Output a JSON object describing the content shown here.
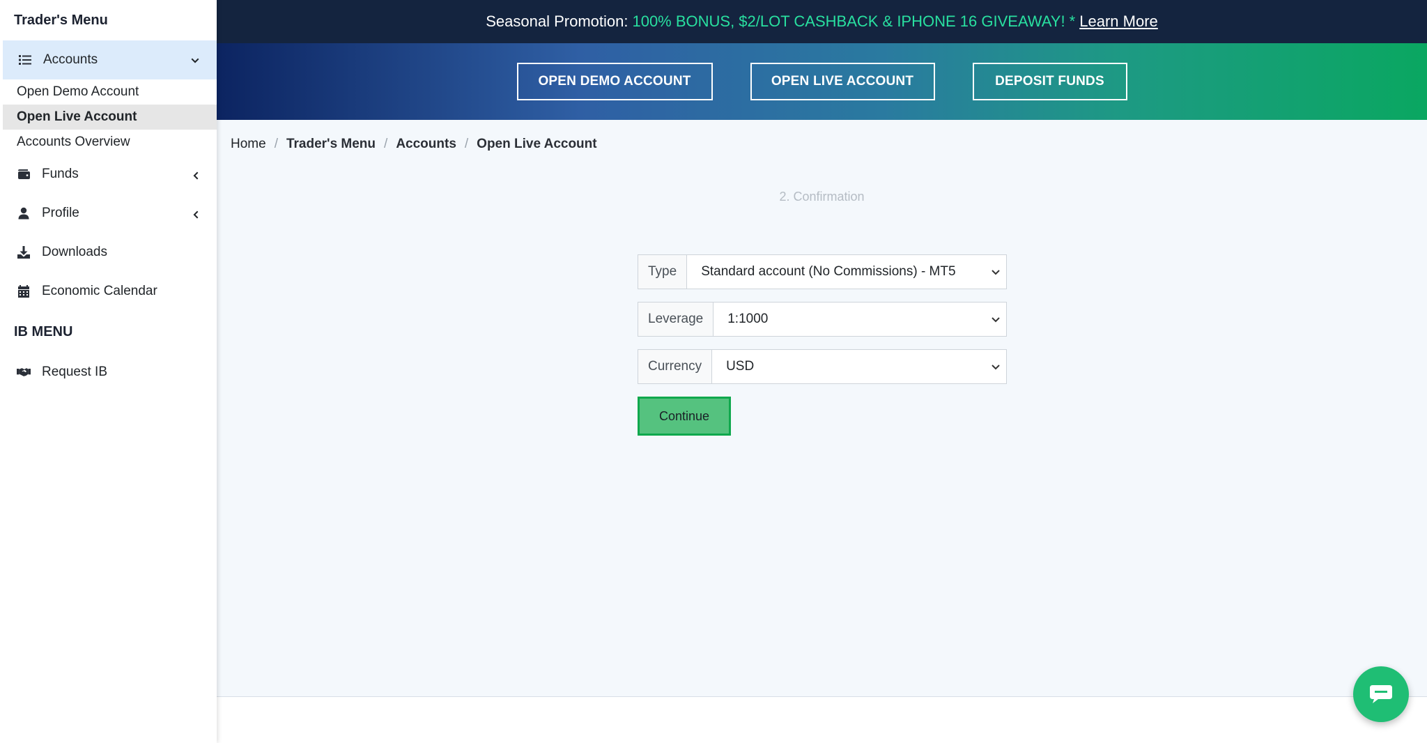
{
  "sidebar": {
    "title": "Trader's Menu",
    "accounts_label": "Accounts",
    "sub_items": [
      "Open Demo Account",
      "Open Live Account",
      "Accounts Overview"
    ],
    "funds_label": "Funds",
    "profile_label": "Profile",
    "downloads_label": "Downloads",
    "calendar_label": "Economic Calendar",
    "ib_heading": "IB MENU",
    "request_ib_label": "Request IB"
  },
  "promo": {
    "prefix": "Seasonal Promotion:",
    "highlight": "100% BONUS, $2/LOT CASHBACK & IPHONE 16 GIVEAWAY! *",
    "link": "Learn More"
  },
  "hero": {
    "demo_button": "OPEN DEMO ACCOUNT",
    "live_button": "OPEN LIVE ACCOUNT",
    "deposit_button": "DEPOSIT FUNDS"
  },
  "breadcrumb": [
    "Home",
    "Trader's Menu",
    "Accounts",
    "Open Live Account"
  ],
  "step_label": "2. Confirmation",
  "form": {
    "type_label": "Type",
    "type_value": "Standard account (No Commissions) - MT5",
    "leverage_label": "Leverage",
    "leverage_value": "1:1000",
    "currency_label": "Currency",
    "currency_value": "USD",
    "continue_label": "Continue"
  },
  "colors": {
    "promo_bg": "#14243f",
    "promo_highlight": "#29e0a0",
    "continue_bg": "#55c27f",
    "chat_bg": "#1fbe74"
  }
}
